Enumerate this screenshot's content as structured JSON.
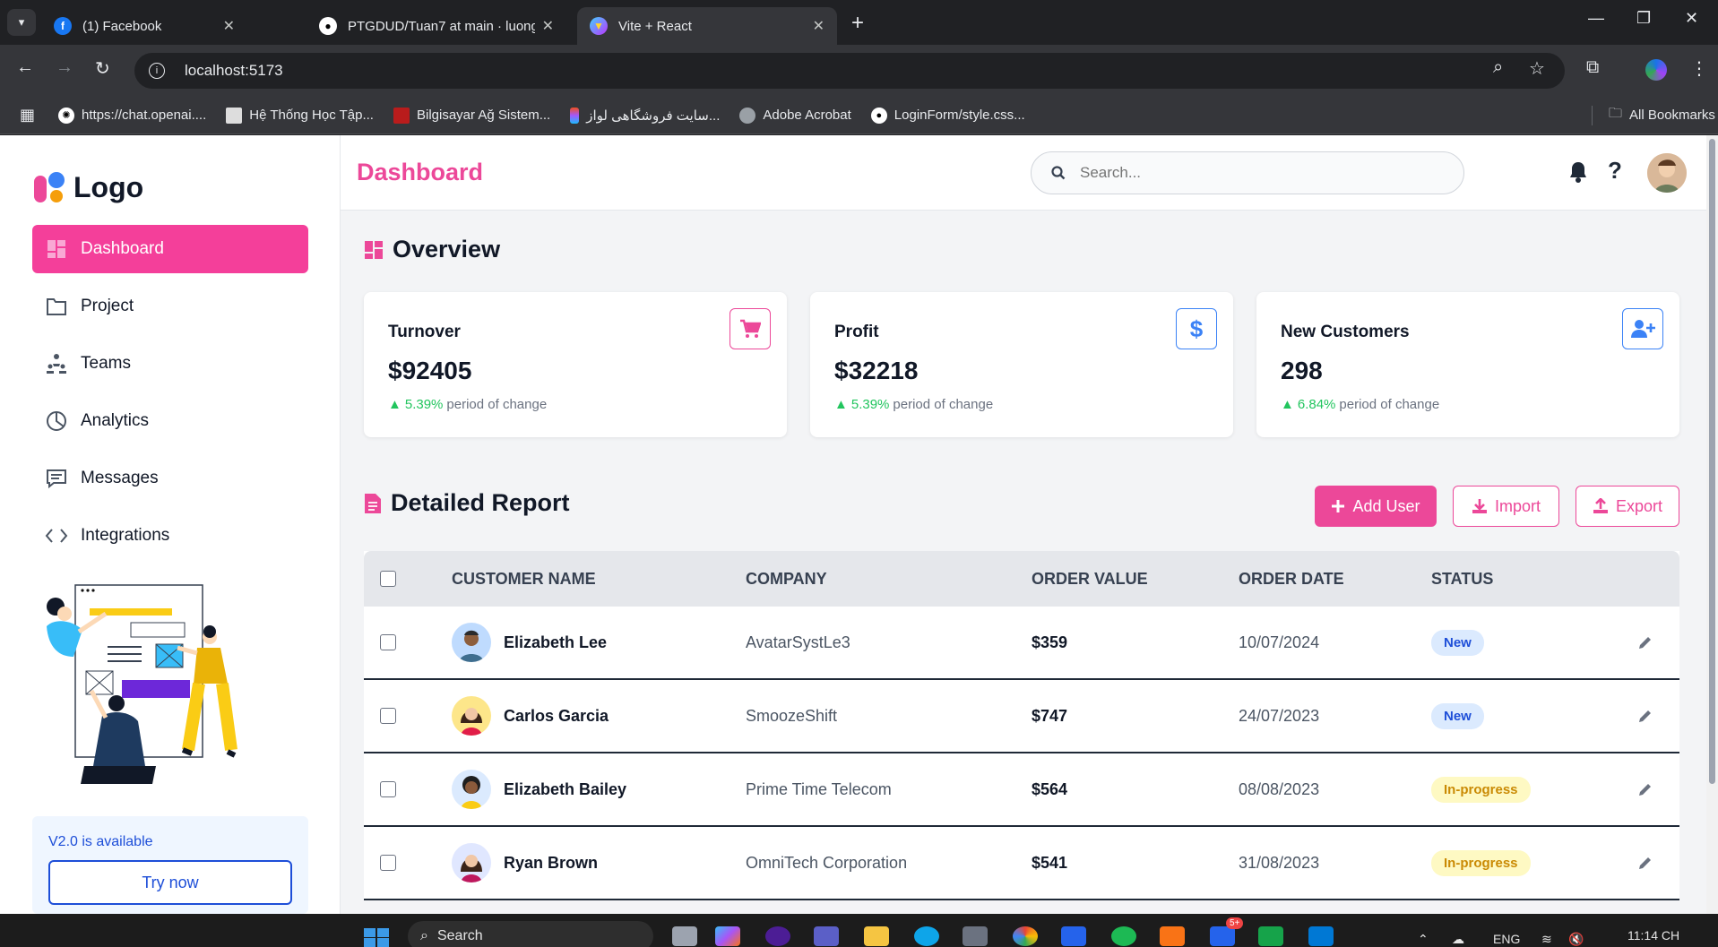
{
  "browser": {
    "tabs": [
      {
        "title": "(1) Facebook",
        "favicon": "facebook-icon",
        "active": false
      },
      {
        "title": "PTGDUD/Tuan7 at main · luong",
        "favicon": "github-icon",
        "active": false
      },
      {
        "title": "Vite + React",
        "favicon": "vite-icon",
        "active": true
      }
    ],
    "url": "localhost:5173",
    "bookmarks": [
      {
        "label": "https://chat.openai....",
        "icon": "openai-icon"
      },
      {
        "label": "Hệ Thống Học Tập...",
        "icon": "page-icon"
      },
      {
        "label": "Bilgisayar Ağ Sistem...",
        "icon": "page-icon"
      },
      {
        "label": "سایت فروشگاهی لواز...",
        "icon": "figma-icon"
      },
      {
        "label": "Adobe Acrobat",
        "icon": "globe-icon"
      },
      {
        "label": "LoginForm/style.css...",
        "icon": "github-icon"
      }
    ],
    "all_bookmarks": "All Bookmarks"
  },
  "sidebar": {
    "logo": "Logo",
    "items": [
      {
        "label": "Dashboard",
        "icon": "dashboard-icon",
        "active": true
      },
      {
        "label": "Project",
        "icon": "folder-icon",
        "active": false
      },
      {
        "label": "Teams",
        "icon": "teams-icon",
        "active": false
      },
      {
        "label": "Analytics",
        "icon": "pie-chart-icon",
        "active": false
      },
      {
        "label": "Messages",
        "icon": "message-icon",
        "active": false
      },
      {
        "label": "Integrations",
        "icon": "code-icon",
        "active": false
      }
    ],
    "promo": {
      "text": "V2.0 is available",
      "button": "Try now"
    }
  },
  "header": {
    "title": "Dashboard",
    "search_placeholder": "Search..."
  },
  "overview": {
    "title": "Overview",
    "cards": [
      {
        "label": "Turnover",
        "value": "$92405",
        "change": "5.39%",
        "change_text": "period of change",
        "icon": "cart-icon",
        "color": "#ec4899"
      },
      {
        "label": "Profit",
        "value": "$32218",
        "change": "5.39%",
        "change_text": "period of change",
        "icon": "dollar-icon",
        "color": "#3b82f6"
      },
      {
        "label": "New Customers",
        "value": "298",
        "change": "6.84%",
        "change_text": "period of change",
        "icon": "user-plus-icon",
        "color": "#3b82f6"
      }
    ]
  },
  "report": {
    "title": "Detailed Report",
    "buttons": {
      "add": "Add User",
      "import": "Import",
      "export": "Export"
    },
    "columns": [
      "CUSTOMER NAME",
      "COMPANY",
      "ORDER VALUE",
      "ORDER DATE",
      "STATUS"
    ],
    "rows": [
      {
        "name": "Elizabeth Lee",
        "company": "AvatarSystLe3",
        "value": "$359",
        "date": "10/07/2024",
        "status": "New"
      },
      {
        "name": "Carlos Garcia",
        "company": "SmoozeShift",
        "value": "$747",
        "date": "24/07/2023",
        "status": "New"
      },
      {
        "name": "Elizabeth Bailey",
        "company": "Prime Time Telecom",
        "value": "$564",
        "date": "08/08/2023",
        "status": "In-progress"
      },
      {
        "name": "Ryan Brown",
        "company": "OmniTech Corporation",
        "value": "$541",
        "date": "31/08/2023",
        "status": "In-progress"
      }
    ]
  },
  "taskbar": {
    "search": "Search",
    "lang": "ENG",
    "time": "11:14 CH",
    "badge": "5+"
  },
  "colors": {
    "accent": "#ec4899",
    "blue": "#3b82f6",
    "green": "#22c55e"
  }
}
